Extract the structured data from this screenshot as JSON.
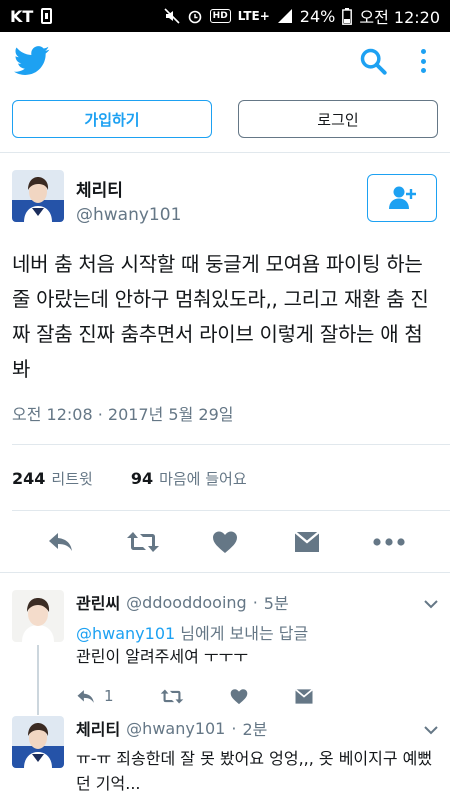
{
  "status_bar": {
    "carrier": "KT",
    "lte": "LTE+",
    "battery": "24%",
    "clock": "오전 12:20"
  },
  "auth": {
    "signup_label": "가입하기",
    "login_label": "로그인"
  },
  "tweet": {
    "author_name": "체리티",
    "author_handle": "@hwany101",
    "text": "네버 춤 처음 시작할 때 둥글게 모여욤 파이팅 하는 줄 아랐는데 안하구 멈춰있도라,, 그리고 재환 춤 진짜 잘춤 진짜 춤추면서 라이브 이렇게 잘하는 애 첨봐",
    "date": "오전 12:08 · 2017년 5월 29일",
    "retweet_count": "244",
    "retweet_label": "리트윗",
    "like_count": "94",
    "like_label": "마음에 들어요"
  },
  "replies": [
    {
      "name": "관린씨",
      "handle": "@ddooddooing",
      "time": "5분",
      "reply_to_mention": "@hwany101",
      "reply_to_suffix": " 님에게 보내는 답글",
      "text": "관린이 알려주세여 ㅜㅜㅜ",
      "reply_count": "1"
    },
    {
      "name": "체리티",
      "handle": "@hwany101",
      "time": "2분",
      "text": "ㅠ-ㅠ 죄송한데 잘 못 봤어요 엉엉,,, 옷 베이지구 예뻤던 기억..."
    }
  ],
  "colors": {
    "brand": "#1da1f2",
    "secondary_text": "#657786",
    "divider": "#e1e8ed"
  }
}
